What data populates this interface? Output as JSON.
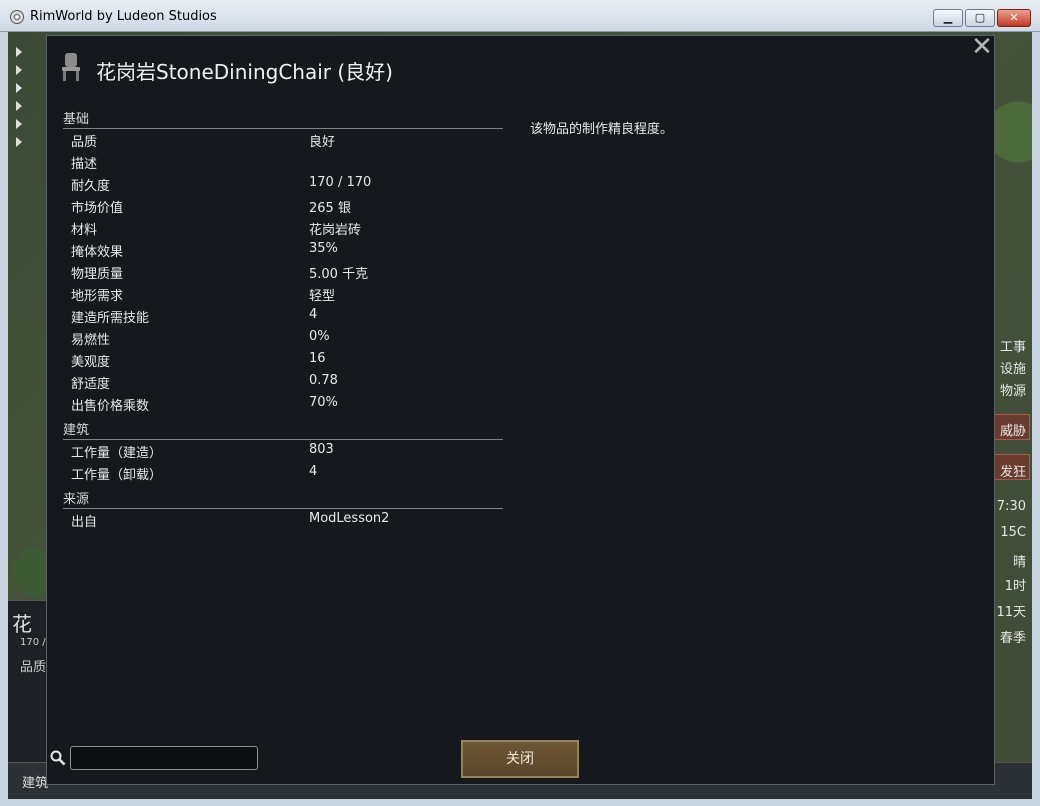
{
  "window": {
    "title": "RimWorld by Ludeon Studios",
    "min_glyph": "▁",
    "max_glyph": "▢",
    "close_glyph": "✕"
  },
  "background": {
    "inspect_name": "花",
    "inspect_hp": "170 /",
    "inspect_quality": "品质",
    "bottom_tab": "建筑",
    "right_hud": [
      "工事",
      "设施",
      "物源",
      "威胁",
      "发狂",
      "7:30",
      "15C",
      "晴",
      "1时",
      "11天",
      "春季"
    ]
  },
  "dialog": {
    "title": "花岗岩StoneDiningChair (良好)",
    "close_glyph": "✕",
    "description": "该物品的制作精良程度。",
    "categories": [
      {
        "name": "基础",
        "stats": [
          {
            "label": "品质",
            "value": "良好"
          },
          {
            "label": "描述",
            "value": ""
          },
          {
            "label": "耐久度",
            "value": "170 / 170"
          },
          {
            "label": "市场价值",
            "value": "265 银"
          },
          {
            "label": "材料",
            "value": "花岗岩砖"
          },
          {
            "label": "掩体效果",
            "value": "35%"
          },
          {
            "label": "物理质量",
            "value": "5.00 千克"
          },
          {
            "label": "地形需求",
            "value": "轻型"
          },
          {
            "label": "建造所需技能",
            "value": "4"
          },
          {
            "label": "易燃性",
            "value": "0%"
          },
          {
            "label": "美观度",
            "value": "16"
          },
          {
            "label": "舒适度",
            "value": "0.78"
          },
          {
            "label": "出售价格乘数",
            "value": "70%"
          }
        ]
      },
      {
        "name": "建筑",
        "stats": [
          {
            "label": "工作量（建造）",
            "value": "803"
          },
          {
            "label": "工作量（卸载）",
            "value": "4"
          }
        ]
      },
      {
        "name": "来源",
        "stats": [
          {
            "label": "出自",
            "value": "ModLesson2"
          }
        ]
      }
    ],
    "search": {
      "value": "",
      "placeholder": ""
    },
    "close_button_label": "关闭"
  },
  "colors": {
    "dialog_bg": "#15191d",
    "button_bg": "#5f4b2d",
    "text": "#e8e8e8"
  }
}
